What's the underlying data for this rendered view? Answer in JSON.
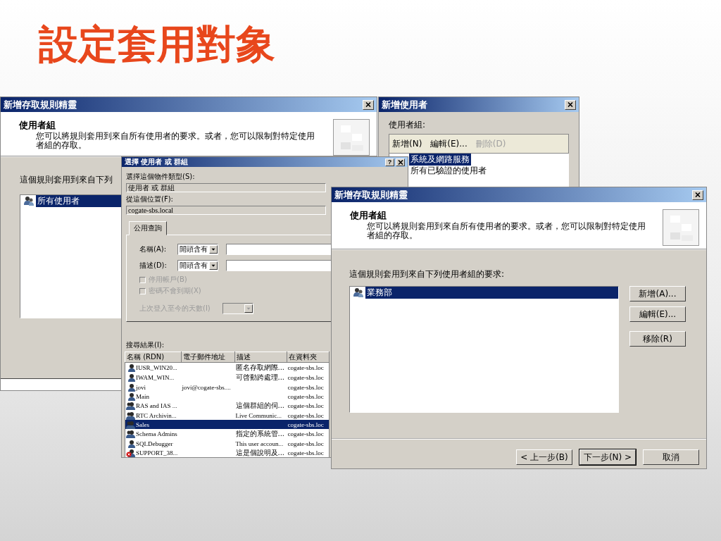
{
  "slide_title": "設定套用對象",
  "back_wizard": {
    "title": "新增存取規則精靈",
    "heading": "使用者組",
    "description": "您可以將規則套用到來自所有使用者的要求。或者，您可以限制對特定使用者組的存取。",
    "list_label": "這個規則套用到來自下列",
    "list_items": [
      {
        "label": "所有使用者",
        "selected": true
      }
    ]
  },
  "add_user_dialog": {
    "title": "新增使用者",
    "list_label": "使用者組:",
    "toolbar": [
      {
        "label": "新增(N)",
        "disabled": false
      },
      {
        "label": "編輯(E)...",
        "disabled": false
      },
      {
        "label": "刪除(D)",
        "disabled": true
      }
    ],
    "list_items": [
      {
        "label": "系統及網路服務",
        "selected": true
      },
      {
        "label": "所有已驗證的使用者",
        "selected": false
      }
    ]
  },
  "select_dialog": {
    "title": "選擇 使用者 或 群組",
    "help": "?",
    "type_label": "選擇這個物件類型(S):",
    "type_value": "使用者 或 群組",
    "location_label": "從這個位置(F):",
    "location_value": "cogate-sbs.local",
    "tabs": [
      {
        "label": "公用查詢",
        "selected": true
      }
    ],
    "query_fields": [
      {
        "label": "名稱(A):",
        "match": "開頭含有"
      },
      {
        "label": "描述(D):",
        "match": "開頭含有"
      }
    ],
    "checkboxes": [
      {
        "label": "停用帳戶(B)",
        "checked": false,
        "disabled": true
      },
      {
        "label": "密碼不會到期(X)",
        "checked": false,
        "disabled": true
      }
    ],
    "days": {
      "label": "上次登入至今的天數(I)",
      "disabled": true
    },
    "results_label": "搜尋結果(I):",
    "results": {
      "columns": [
        "名稱 (RDN)",
        "電子郵件地址",
        "描述",
        "在資料夾"
      ],
      "rows": [
        {
          "name": "IUSR_WIN20...",
          "description": "匿名存取網際...",
          "folder": "cogate-sbs.loc",
          "kind": "user",
          "selected": false
        },
        {
          "name": "IWAM_WIN...",
          "description": "可啓動跨處理...",
          "folder": "cogate-sbs.loc",
          "kind": "user",
          "selected": false
        },
        {
          "name": "jovi",
          "email": "jovi@cogate-sbs....",
          "folder": "cogate-sbs.loc",
          "kind": "user",
          "selected": false
        },
        {
          "name": "Main",
          "folder": "cogate-sbs.loc",
          "kind": "user",
          "selected": false
        },
        {
          "name": "RAS and IAS ...",
          "description": "這個群組的伺...",
          "folder": "cogate-sbs.loc",
          "kind": "group",
          "selected": false
        },
        {
          "name": "RTC Archivin...",
          "description": "Live Communic...",
          "folder": "cogate-sbs.loc",
          "kind": "group",
          "selected": false
        },
        {
          "name": "Sales",
          "folder": "cogate-sbs.loc",
          "kind": "group",
          "selected": true
        },
        {
          "name": "Schema Admins",
          "description": "指定的系統管...",
          "folder": "cogate-sbs.loc",
          "kind": "group",
          "selected": false
        },
        {
          "name": "SQLDebugger",
          "description": "This user accoun...",
          "folder": "cogate-sbs.loc",
          "kind": "user",
          "selected": false
        },
        {
          "name": "SUPPORT_38...",
          "description": "這是個說明及...",
          "folder": "cogate-sbs.loc",
          "kind": "disabled-user",
          "selected": false
        }
      ]
    }
  },
  "front_wizard": {
    "title": "新增存取規則精靈",
    "heading": "使用者組",
    "description": "您可以將規則套用到來自所有使用者的要求。或者，您可以限制對特定使用者組的存取。",
    "list_label": "這個規則套用到來自下列使用者組的要求:",
    "list_items": [
      {
        "label": "業務部",
        "selected": true
      }
    ],
    "side_buttons": [
      "新增(A)...",
      "編輯(E)...",
      "移除(R)"
    ],
    "nav_buttons": [
      {
        "label": "< 上一步(B)",
        "default": false
      },
      {
        "label": "下一步(N) >",
        "default": true
      },
      {
        "label": "取消",
        "default": false
      }
    ]
  }
}
